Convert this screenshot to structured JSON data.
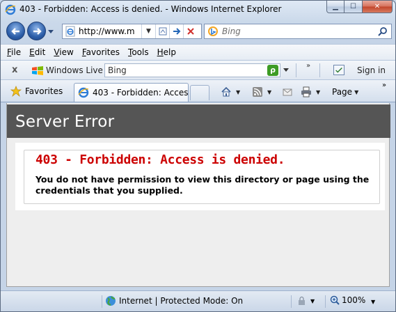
{
  "window": {
    "title": "403 - Forbidden: Access is denied. - Windows Internet Explorer",
    "min_glyph": "▁",
    "max_glyph": "☐",
    "close_glyph": "✕"
  },
  "address": {
    "url": "http://www.m",
    "search_placeholder": "Bing"
  },
  "menu": {
    "items": [
      "File",
      "Edit",
      "View",
      "Favorites",
      "Tools",
      "Help"
    ]
  },
  "live_toolbar": {
    "close": "x",
    "brand": "Windows Live",
    "search_value": "Bing",
    "chevron": "»",
    "sign_in": "Sign in"
  },
  "tabs": {
    "favorites_label": "Favorites",
    "active_tab": "403 - Forbidden: Access ...",
    "page_label": "Page",
    "chevron": "»"
  },
  "page": {
    "header_title": "Server Error",
    "error_title": "403 - Forbidden: Access is denied.",
    "error_message": "You do not have permission to view this directory or page using the credentials that you supplied."
  },
  "status": {
    "zone": "Internet | Protected Mode: On",
    "zoom": "100%"
  },
  "icons": {
    "back": "back-arrow-icon",
    "forward": "forward-arrow-icon",
    "ie": "internet-explorer-icon",
    "bing": "bing-icon",
    "home": "home-icon",
    "feeds": "feeds-icon",
    "mail": "mail-icon",
    "print": "printer-icon",
    "globe": "globe-icon",
    "zoom": "zoom-icon"
  },
  "colors": {
    "header_bg": "#555555",
    "error_red": "#cc0000",
    "content_bg": "#eeeeee"
  }
}
